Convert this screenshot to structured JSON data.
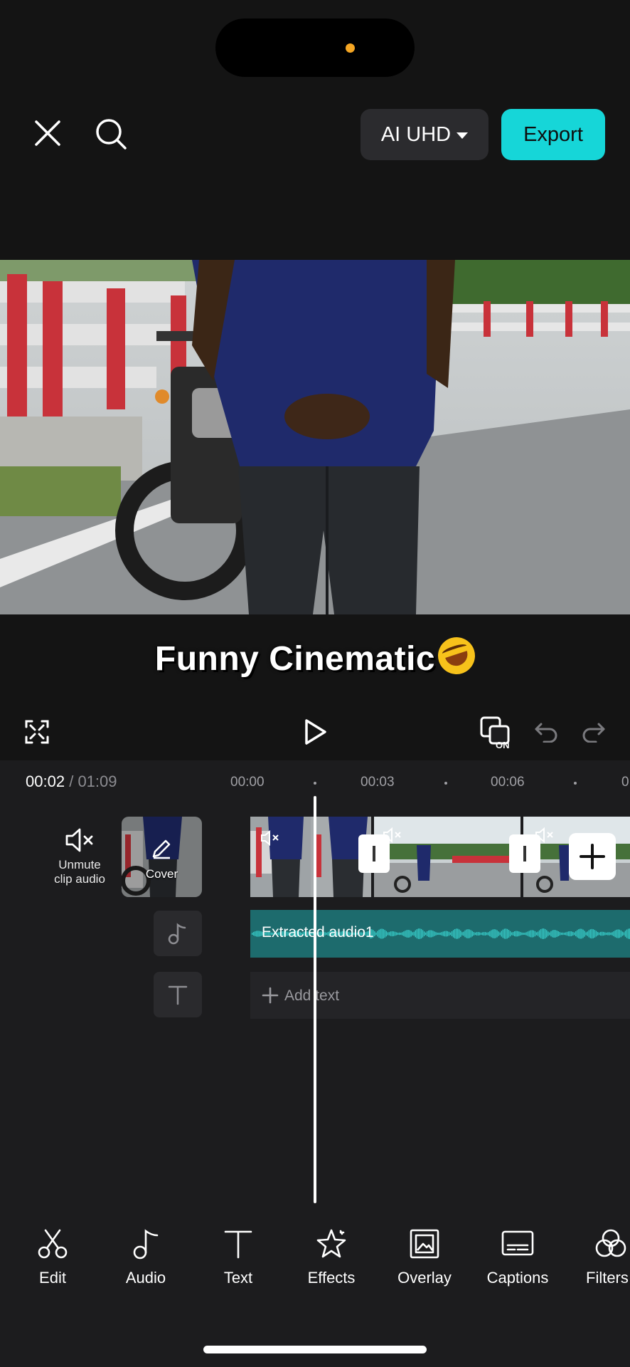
{
  "header": {
    "close_icon": "close-icon",
    "search_icon": "search-icon",
    "quality_label": "AI UHD",
    "export_label": "Export"
  },
  "preview": {
    "caption_text": "Funny Cinematic",
    "caption_emoji": "rolling-on-floor-laughing-emoji"
  },
  "playback": {
    "current_time": "00:02",
    "separator": "/",
    "total_time": "01:09",
    "ruler_marks": [
      "00:00",
      "00:03",
      "00:06",
      "0"
    ]
  },
  "tracks": {
    "unmute_label_line1": "Unmute",
    "unmute_label_line2": "clip audio",
    "cover_label": "Cover",
    "audio_label": "Extracted audio1",
    "add_text_label": "Add text"
  },
  "toolbar": {
    "items": [
      {
        "label": "Edit",
        "icon": "scissors-icon"
      },
      {
        "label": "Audio",
        "icon": "music-note-icon"
      },
      {
        "label": "Text",
        "icon": "text-icon"
      },
      {
        "label": "Effects",
        "icon": "star-effects-icon"
      },
      {
        "label": "Overlay",
        "icon": "overlay-icon"
      },
      {
        "label": "Captions",
        "icon": "captions-icon"
      },
      {
        "label": "Filters",
        "icon": "filters-icon"
      }
    ]
  },
  "colors": {
    "accent": "#16d6d8",
    "background": "#1c1c1e",
    "audio_track": "#1d6b6d"
  }
}
